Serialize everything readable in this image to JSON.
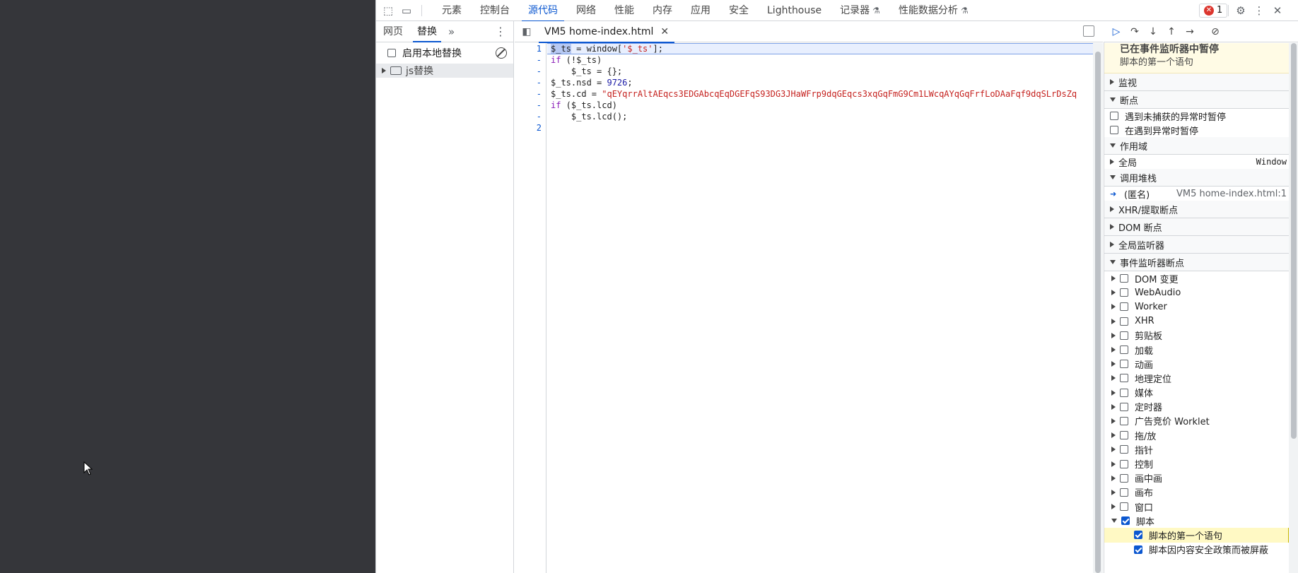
{
  "top_tabs": [
    {
      "label": "元素",
      "active": false
    },
    {
      "label": "控制台",
      "active": false
    },
    {
      "label": "源代码",
      "active": true
    },
    {
      "label": "网络",
      "active": false
    },
    {
      "label": "性能",
      "active": false
    },
    {
      "label": "内存",
      "active": false
    },
    {
      "label": "应用",
      "active": false
    },
    {
      "label": "安全",
      "active": false
    },
    {
      "label": "Lighthouse",
      "active": false
    },
    {
      "label": "记录器",
      "active": false,
      "flask": true
    },
    {
      "label": "性能数据分析",
      "active": false,
      "flask": true
    }
  ],
  "error_count": "1",
  "left_panel": {
    "tabs": [
      "网页",
      "替换"
    ],
    "enable_local_overrides": "启用本地替换",
    "folder": "js替换"
  },
  "editor": {
    "file_tab": "VM5 home-index.html",
    "gutter": [
      "1",
      "-",
      "-",
      "-",
      "-",
      "-",
      "-",
      "2"
    ]
  },
  "debugger": {
    "paused_title": "已在事件监听器中暂停",
    "paused_reason": "脚本的第一个语句",
    "sections": {
      "watch": "监视",
      "breakpoints": "断点",
      "pause_uncaught": "遇到未捕获的异常时暂停",
      "pause_caught": "在遇到异常时暂停",
      "scope": "作用域",
      "global": "全局",
      "global_value": "Window",
      "call_stack": "调用堆栈",
      "anon": "(匿名)",
      "anon_loc": "VM5 home-index.html:1",
      "xhr": "XHR/提取断点",
      "dom": "DOM 断点",
      "global_listeners": "全局监听器",
      "event_listeners": "事件监听器断点"
    },
    "event_items": [
      {
        "label": "DOM 变更",
        "checked": false
      },
      {
        "label": "WebAudio",
        "checked": false
      },
      {
        "label": "Worker",
        "checked": false
      },
      {
        "label": "XHR",
        "checked": false
      },
      {
        "label": "剪贴板",
        "checked": false
      },
      {
        "label": "加载",
        "checked": false
      },
      {
        "label": "动画",
        "checked": false
      },
      {
        "label": "地理定位",
        "checked": false
      },
      {
        "label": "媒体",
        "checked": false
      },
      {
        "label": "定时器",
        "checked": false
      },
      {
        "label": "广告竞价 Worklet",
        "checked": false
      },
      {
        "label": "拖/放",
        "checked": false
      },
      {
        "label": "指针",
        "checked": false
      },
      {
        "label": "控制",
        "checked": false
      },
      {
        "label": "画中画",
        "checked": false
      },
      {
        "label": "画布",
        "checked": false
      },
      {
        "label": "窗口",
        "checked": false
      },
      {
        "label": "脚本",
        "checked": true,
        "expanded": true
      }
    ],
    "script_sub_items": [
      {
        "label": "脚本的第一个语句",
        "checked": true,
        "highlight": true
      },
      {
        "label": "脚本因内容安全政策而被屏蔽",
        "checked": true,
        "highlight": false
      }
    ]
  }
}
